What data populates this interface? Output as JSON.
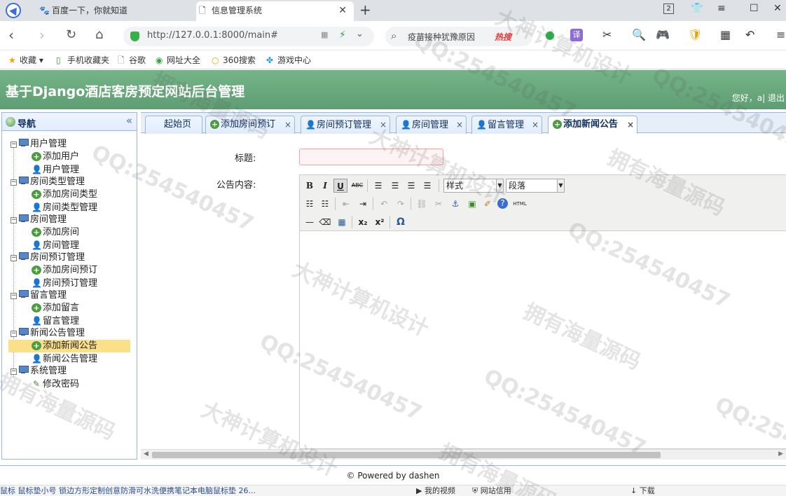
{
  "browser": {
    "tabs": [
      {
        "title": "百度一下，你就知道"
      },
      {
        "title": "信息管理系统"
      }
    ],
    "tab_badge": "2",
    "url": "http://127.0.0.1:8000/main#",
    "search_text": "疫苗接种犹豫原因",
    "search_hot": "热搜",
    "translate_label": "译",
    "bookmarks": [
      "收藏",
      "手机收藏夹",
      "谷歌",
      "网址大全",
      "360搜索",
      "游戏中心"
    ]
  },
  "header": {
    "title": "基于Django酒店客房预定网站后台管理",
    "user_text": "您好，a| 退出"
  },
  "sidebar": {
    "title": "导航",
    "collapse_glyph": "«",
    "groups": [
      {
        "label": "用户管理",
        "items": [
          "添加用户",
          "用户管理"
        ]
      },
      {
        "label": "房间类型管理",
        "items": [
          "添加房间类型",
          "房间类型管理"
        ]
      },
      {
        "label": "房间管理",
        "items": [
          "添加房间",
          "房间管理"
        ]
      },
      {
        "label": "房间预订管理",
        "items": [
          "添加房间预订",
          "房间预订管理"
        ]
      },
      {
        "label": "留言管理",
        "items": [
          "添加留言",
          "留言管理"
        ]
      },
      {
        "label": "新闻公告管理",
        "items": [
          "添加新闻公告",
          "新闻公告管理"
        ]
      },
      {
        "label": "系统管理",
        "items": [
          "修改密码"
        ]
      }
    ]
  },
  "page_tabs": [
    {
      "label": "起始页"
    },
    {
      "label": "添加房间预订"
    },
    {
      "label": "房间预订管理"
    },
    {
      "label": "房间管理"
    },
    {
      "label": "留言管理"
    },
    {
      "label": "添加新闻公告"
    }
  ],
  "form": {
    "title_label": "标题:",
    "title_value": "",
    "content_label": "公告内容:",
    "style_select": "样式",
    "paragraph_select": "段落"
  },
  "footer": "© Powered by dashen",
  "statusbar": {
    "news": "鼠标 鼠标垫小号 锁边方形定制创意防滑可水洗便携笔记本电脑鼠标垫 26...",
    "video": "我的视频",
    "trust": "网站信用",
    "download": "下载"
  },
  "watermarks": [
    "QQ:254540457",
    "大神计算机设计",
    "拥有海量源码"
  ],
  "colors": {
    "header_bg": "#6aaa7a",
    "selected_bg": "#fbe08a",
    "panel_border": "#95b8e7"
  }
}
